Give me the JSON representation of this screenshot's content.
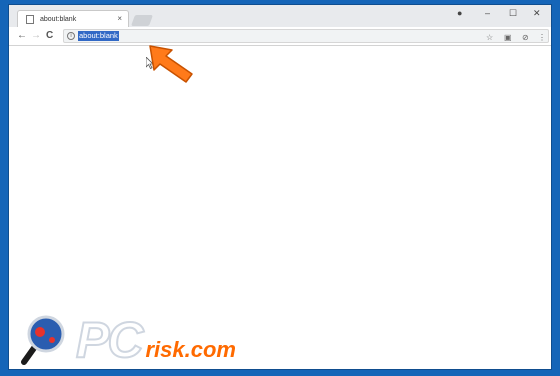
{
  "browser": {
    "tab": {
      "title": "about:blank",
      "close_glyph": "×"
    },
    "window_controls": {
      "account": "●",
      "minimize": "–",
      "maximize": "☐",
      "close": "✕"
    },
    "nav": {
      "back": "←",
      "forward": "→",
      "reload": "C"
    },
    "omnibox": {
      "info_glyph": "i",
      "url": "about:blank"
    },
    "toolbar_icons": {
      "star": "☆",
      "ext1": "▣",
      "ext2": "⊘",
      "menu": "⋮"
    }
  },
  "colors": {
    "desktop": "#1565b8",
    "selection": "#3169c6",
    "arrow": "#ff7a1a",
    "logo_accent": "#ff6a00"
  },
  "watermark": {
    "pc": "PC",
    "risk": "risk.com"
  }
}
